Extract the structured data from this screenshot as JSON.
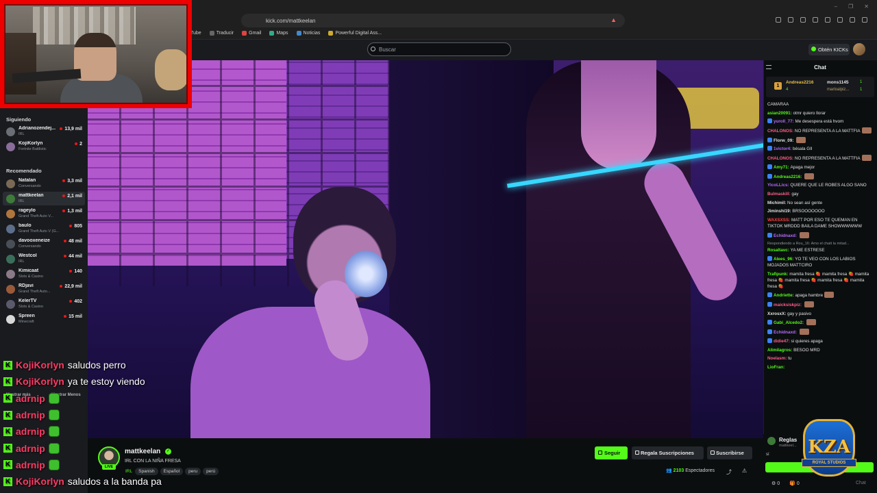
{
  "browser": {
    "url": "kick.com/mattkeelan",
    "bookmarks": [
      "Tube",
      "Traducir",
      "Gmail",
      "Maps",
      "Noticias",
      "Powerful Digital Ass..."
    ]
  },
  "topbar": {
    "search_placeholder": "Buscar",
    "kicks_label": "Obtén KICKs"
  },
  "sidebar": {
    "following_heading": "Siguiendo",
    "following": [
      {
        "name": "Adrianozendej...",
        "category": "IRL",
        "viewers": "13,9 mil",
        "color": "#6b6f75"
      },
      {
        "name": "KojiKorlyn",
        "category": "Fortnite Battlistic",
        "viewers": "2",
        "color": "#8a6d9a"
      }
    ],
    "recommended_heading": "Recomendado",
    "recommended": [
      {
        "name": "Natalan",
        "category": "Conversando",
        "viewers": "3,3 mil",
        "color": "#7a6a55"
      },
      {
        "name": "mattkeelan",
        "category": "IRL",
        "viewers": "2,1 mil",
        "color": "#3e7a3a",
        "active": true
      },
      {
        "name": "rageylo",
        "category": "Grand Theft Auto V...",
        "viewers": "1,3 mil",
        "color": "#b0753d"
      },
      {
        "name": "baulo",
        "category": "Grand Theft Auto V (G...",
        "viewers": "805",
        "color": "#5c6e8a"
      },
      {
        "name": "davooxeneize",
        "category": "Conversando",
        "viewers": "48 mil",
        "color": "#4a4f57"
      },
      {
        "name": "Westcol",
        "category": "IRL",
        "viewers": "44 mil",
        "color": "#3b6e5a"
      },
      {
        "name": "Kimicaat",
        "category": "Slots & Casino",
        "viewers": "140",
        "color": "#8a7a88"
      },
      {
        "name": "RDjavi",
        "category": "Grand Theft Auto...",
        "viewers": "22,9 mil",
        "color": "#9a5a3a"
      },
      {
        "name": "KelerTV",
        "category": "Slots & Casino",
        "viewers": "402",
        "color": "#5a5a6a"
      },
      {
        "name": "Spreen",
        "category": "Minecraft",
        "viewers": "15 mil",
        "color": "#d8d8d8"
      }
    ],
    "show_more": "Mostrar más",
    "show_less": "Mostrar Menos"
  },
  "stream": {
    "streamer": "mattkeelan",
    "title": "IRL CON LA NIÑA FRESA",
    "live_label": "LIVE",
    "category": "IRL",
    "tags": [
      "Spanish",
      "Español",
      "peru",
      "perú"
    ],
    "follow_label": "Seguir",
    "gift_label": "Regala Suscripciones",
    "subscribe_label": "Suscribirse",
    "viewers_count": "2103",
    "viewers_label": "Espectadores"
  },
  "overlay_chat": [
    {
      "user": "KojiKorlyn",
      "message": "saludos perro",
      "emote": false
    },
    {
      "user": "KojiKorlyn",
      "message": "ya te estoy viendo",
      "emote": false
    },
    {
      "user": "adrnip",
      "message": "",
      "emote": true
    },
    {
      "user": "adrnip",
      "message": "",
      "emote": true
    },
    {
      "user": "adrnip",
      "message": "",
      "emote": true
    },
    {
      "user": "adrnip",
      "message": "",
      "emote": true
    },
    {
      "user": "adrnip",
      "message": "",
      "emote": true
    },
    {
      "user": "KojiKorlyn",
      "message": "saludos a la banda pa",
      "emote": false
    }
  ],
  "overlay_badge_letter": "K",
  "chat": {
    "title": "Chat",
    "pinned": {
      "user1": "Andreas2216",
      "count1": "4",
      "user2": "mons1145",
      "count2": "1",
      "user3": "marloalpiz...",
      "count3": "1",
      "rank": "1"
    },
    "messages": [
      {
        "user": "",
        "text": "CAMARAA",
        "color": "#e1e1e1"
      },
      {
        "user": "asian20091",
        "text": "otmr quiero llorar",
        "color": "#53fc18"
      },
      {
        "user": "yuroll_77",
        "text": "Me desespera está hvom",
        "color": "#b46bff",
        "badge": true
      },
      {
        "user": "CHALONOS",
        "text": "NO REPRESENTA A LA MATTFIA",
        "color": "#ff5f8a",
        "emote": true
      },
      {
        "user": "Florw_09",
        "text": "",
        "color": "#e1e1e1",
        "badge": true,
        "emote": true
      },
      {
        "user": "1victor4",
        "text": "bésala GIl",
        "color": "#b46bff",
        "badge": true
      },
      {
        "user": "CHALONOS",
        "text": "NO REPRESENTA A LA MATTFIA",
        "color": "#ff5f8a",
        "emote": true
      },
      {
        "user": "Amy71",
        "text": "Apaga mejor",
        "color": "#53fc18",
        "badge": true
      },
      {
        "user": "Andreas2216",
        "text": "",
        "color": "#53fc18",
        "badge": true,
        "emote": true
      },
      {
        "user": "YicoLLics",
        "text": "QUIERE QUE LE ROBES ALGO SANO",
        "color": "#b46bff"
      },
      {
        "user": "Bulmaskill",
        "text": "gay",
        "color": "#ff5f8a"
      },
      {
        "user": "Michimil",
        "text": "No sean así gente",
        "color": "#e1e1e1"
      },
      {
        "user": "Jiminshi19",
        "text": "BRSOOOOOOO",
        "color": "#e1e1e1"
      },
      {
        "user": "WAXSXSS",
        "text": "MATT POR ESO TE QUEMAN EN TIKTOK MRDDD BAILA DAME SHOWWWWWW",
        "color": "#ff4040"
      },
      {
        "user": "Echidnaxd",
        "text": "",
        "color": "#b46bff",
        "badge": true,
        "emote": true
      },
      {
        "user": "Rosaltavc",
        "text": "YA ME ESTRESE",
        "color": "#53fc18",
        "reply": "Respondiendo a Rou_16: Amo el chatt la mitad..."
      },
      {
        "user": "Alees_96",
        "text": "YO TE VEO CON LOS LABIOS MOJADOS MATTCIRO",
        "color": "#53fc18",
        "badge": true
      },
      {
        "user": "Trafipunk",
        "text": "mamita fresa 🍓 mamita fresa 🍓 mamita fresa 🍓 mamita fresa 🍓 mamita fresa 🍓 mamita fresa 🍓",
        "color": "#53fc18"
      },
      {
        "user": "Andriette",
        "text": "apaga hambre",
        "color": "#53fc18",
        "badge": true,
        "emote": true
      },
      {
        "user": "maicksiskpiz",
        "text": "",
        "color": "#ff5f8a",
        "badge": true,
        "emote": true
      },
      {
        "user": "XxrosxX",
        "text": "gay y pasivo",
        "color": "#e1e1e1"
      },
      {
        "user": "Gabi_Alcedo2",
        "text": "",
        "color": "#53fc18",
        "badge": true,
        "emote": true
      },
      {
        "user": "Echidnaxd",
        "text": "",
        "color": "#b46bff",
        "badge": true,
        "emote": true
      },
      {
        "user": "didie47",
        "text": "si quieres apaga",
        "color": "#ff5f8a",
        "badge": true
      },
      {
        "user": "Alimilagros",
        "text": "BESOO MRD",
        "color": "#53fc18"
      },
      {
        "user": "Noelasm",
        "text": "tu",
        "color": "#ff5f8a"
      },
      {
        "user": "LioFran",
        "text": "",
        "color": "#53fc18"
      }
    ],
    "rules_title": "Reglas",
    "rules_sub": "mattkeel...",
    "rules_reply": "sí",
    "footer_a": "0",
    "footer_b": "0",
    "chat_button": "Chat"
  },
  "logo": {
    "title": "KZA",
    "subtitle": "ROYAL STUDIOS"
  }
}
